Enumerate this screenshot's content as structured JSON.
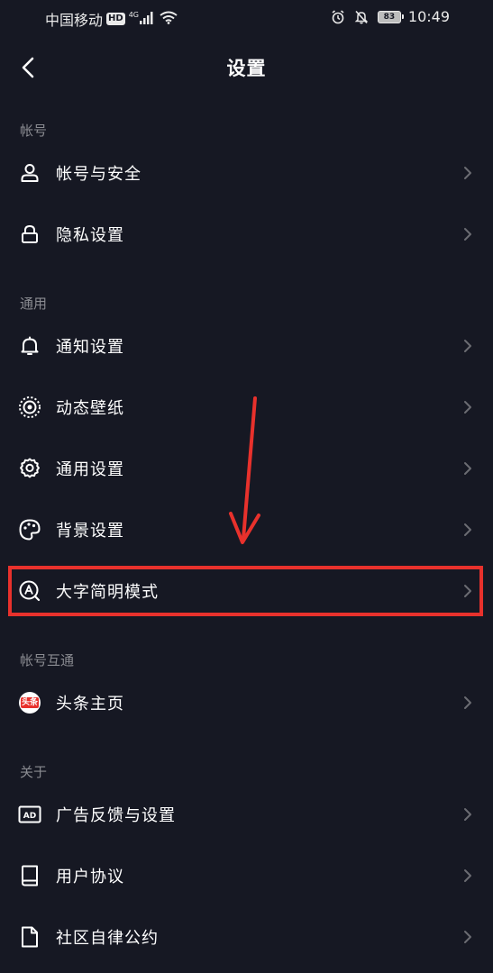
{
  "status_bar": {
    "carrier": "中国移动",
    "hd": "HD",
    "network": "4G",
    "battery": "83",
    "time": "10:49",
    "icons": [
      "signal-icon",
      "wifi-icon",
      "alarm-icon",
      "mute-icon",
      "battery-icon"
    ]
  },
  "header": {
    "title": "设置",
    "back_icon": "back-chevron-icon"
  },
  "sections": [
    {
      "label": "帐号",
      "items": [
        {
          "label": "帐号与安全",
          "icon": "user-icon"
        },
        {
          "label": "隐私设置",
          "icon": "lock-icon"
        }
      ]
    },
    {
      "label": "通用",
      "items": [
        {
          "label": "通知设置",
          "icon": "bell-icon"
        },
        {
          "label": "动态壁纸",
          "icon": "live-wallpaper-icon"
        },
        {
          "label": "通用设置",
          "icon": "gear-icon"
        },
        {
          "label": "背景设置",
          "icon": "palette-icon"
        },
        {
          "label": "大字简明模式",
          "icon": "large-text-icon"
        }
      ]
    },
    {
      "label": "帐号互通",
      "items": [
        {
          "label": "头条主页",
          "icon": "toutiao-icon",
          "badge_text": "头条"
        }
      ]
    },
    {
      "label": "关于",
      "items": [
        {
          "label": "广告反馈与设置",
          "icon": "ad-icon",
          "icon_text": "AD"
        },
        {
          "label": "用户协议",
          "icon": "book-icon"
        },
        {
          "label": "社区自律公约",
          "icon": "document-icon"
        }
      ]
    }
  ],
  "annotation": {
    "highlight_color": "#e8312c",
    "highlighted_item": "大字简明模式"
  },
  "colors": {
    "background": "#161823",
    "text": "#ffffff",
    "section_label": "#8a8b91",
    "chevron": "#6b6c72",
    "annotation": "#e8312c"
  }
}
